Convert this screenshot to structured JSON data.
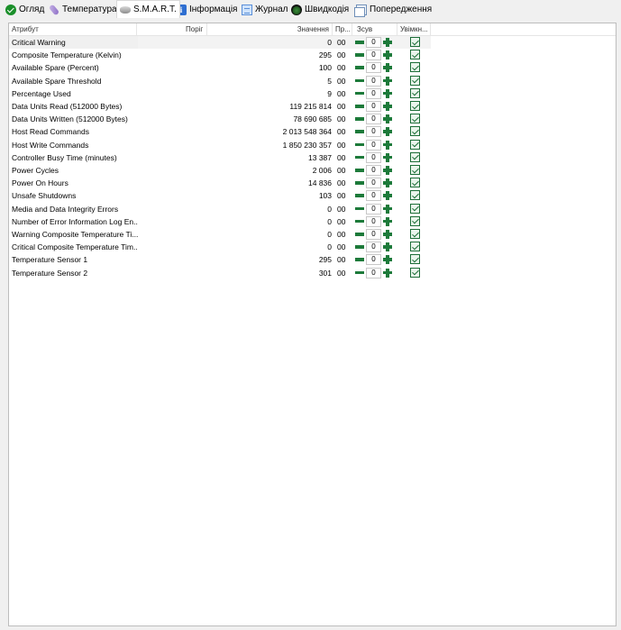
{
  "tabs": [
    {
      "label": "Огляд",
      "icon": "check-circle-icon"
    },
    {
      "label": "Температура",
      "icon": "thermometer-icon"
    },
    {
      "label": "S.M.A.R.T.",
      "icon": "disk-icon",
      "active": true
    },
    {
      "label": "Інформація",
      "icon": "info-icon"
    },
    {
      "label": "Журнал",
      "icon": "log-icon"
    },
    {
      "label": "Швидкодія",
      "icon": "speedometer-icon"
    },
    {
      "label": "Попередження",
      "icon": "warning-pages-icon"
    }
  ],
  "table": {
    "columns": {
      "attribute": "Атрибут",
      "threshold": "Поріг",
      "value": "Значення",
      "raw": "Пр...",
      "offset": "Зсув",
      "enabled": "Увімкн..."
    },
    "rows": [
      {
        "attribute": "Critical Warning",
        "value": "0",
        "raw": "00",
        "offset": "0",
        "enabled": true
      },
      {
        "attribute": "Composite Temperature (Kelvin)",
        "value": "295",
        "raw": "00",
        "offset": "0",
        "enabled": true
      },
      {
        "attribute": "Available Spare (Percent)",
        "value": "100",
        "raw": "00",
        "offset": "0",
        "enabled": true
      },
      {
        "attribute": "Available Spare Threshold",
        "value": "5",
        "raw": "00",
        "offset": "0",
        "enabled": true
      },
      {
        "attribute": "Percentage Used",
        "value": "9",
        "raw": "00",
        "offset": "0",
        "enabled": true
      },
      {
        "attribute": "Data Units Read (512000 Bytes)",
        "value": "119 215 814",
        "raw": "00",
        "offset": "0",
        "enabled": true
      },
      {
        "attribute": "Data Units Written (512000 Bytes)",
        "value": "78 690 685",
        "raw": "00",
        "offset": "0",
        "enabled": true
      },
      {
        "attribute": "Host Read Commands",
        "value": "2 013 548 364",
        "raw": "00",
        "offset": "0",
        "enabled": true
      },
      {
        "attribute": "Host Write Commands",
        "value": "1 850 230 357",
        "raw": "00",
        "offset": "0",
        "enabled": true
      },
      {
        "attribute": "Controller Busy Time (minutes)",
        "value": "13 387",
        "raw": "00",
        "offset": "0",
        "enabled": true
      },
      {
        "attribute": "Power Cycles",
        "value": "2 006",
        "raw": "00",
        "offset": "0",
        "enabled": true
      },
      {
        "attribute": "Power On Hours",
        "value": "14 836",
        "raw": "00",
        "offset": "0",
        "enabled": true
      },
      {
        "attribute": "Unsafe Shutdowns",
        "value": "103",
        "raw": "00",
        "offset": "0",
        "enabled": true
      },
      {
        "attribute": "Media and Data Integrity Errors",
        "value": "0",
        "raw": "00",
        "offset": "0",
        "enabled": true
      },
      {
        "attribute": "Number of Error Information Log En...",
        "value": "0",
        "raw": "00",
        "offset": "0",
        "enabled": true
      },
      {
        "attribute": "Warning Composite Temperature Ti...",
        "value": "0",
        "raw": "00",
        "offset": "0",
        "enabled": true
      },
      {
        "attribute": "Critical Composite Temperature Tim...",
        "value": "0",
        "raw": "00",
        "offset": "0",
        "enabled": true
      },
      {
        "attribute": "Temperature Sensor 1",
        "value": "295",
        "raw": "00",
        "offset": "0",
        "enabled": true
      },
      {
        "attribute": "Temperature Sensor 2",
        "value": "301",
        "raw": "00",
        "offset": "0",
        "enabled": true
      }
    ]
  },
  "colors": {
    "accent_green": "#1d7a3a",
    "panel_background": "#ffffff",
    "window_background": "#f0f0f0"
  }
}
